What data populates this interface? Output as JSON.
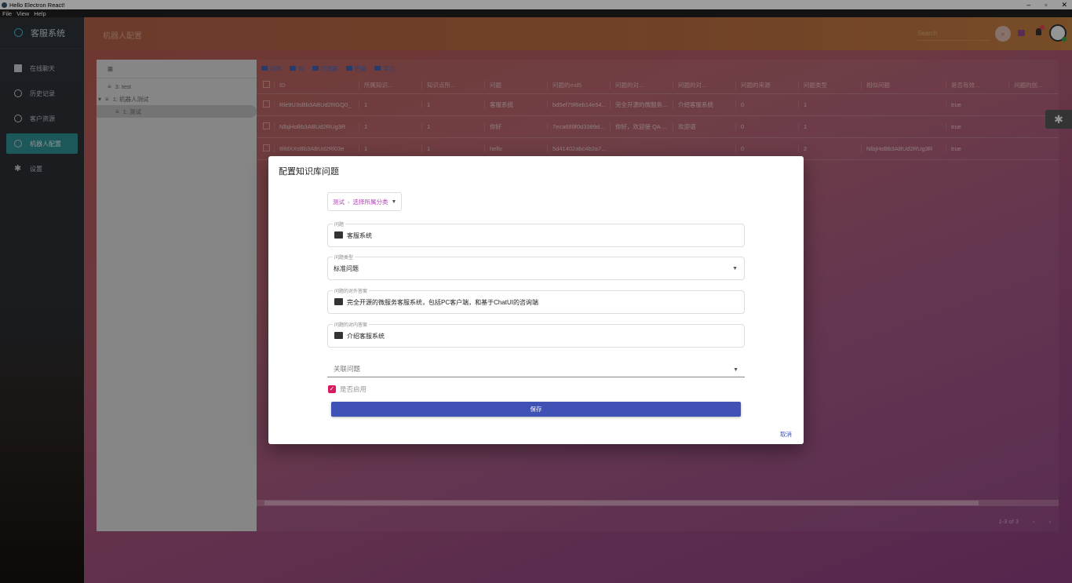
{
  "window": {
    "title": "Hello Electron React!"
  },
  "menu": [
    "File",
    "View",
    "Help"
  ],
  "sidebar": {
    "brand": "客服系统",
    "items": [
      {
        "label": "在线聊天"
      },
      {
        "label": "历史记录"
      },
      {
        "label": "客户资源"
      },
      {
        "label": "机器人配置"
      },
      {
        "label": "设置"
      }
    ]
  },
  "header": {
    "title": "机器人配置",
    "search_placeholder": "Search"
  },
  "tree": {
    "nodes": [
      {
        "label": "3: test"
      },
      {
        "label": "1: 机器人测试"
      },
      {
        "label": "1: 测试"
      }
    ]
  },
  "table": {
    "toolbar": [
      "列表",
      "列",
      "过滤器",
      "密度",
      "导出"
    ],
    "columns": [
      "ID",
      "所属知识...",
      "知识点所...",
      "问题",
      "问题的md5",
      "问题的对...",
      "问题的对...",
      "问题的来源",
      "问题类型",
      "相似问题",
      "是否有效...",
      "问题的创..."
    ],
    "rows": [
      [
        "Rle9U3sBb3ABUd2RGQ0_",
        "1",
        "1",
        "客服系统",
        "bd5ef79f6eb14e54...",
        "完全开源的微服务...",
        "介绍客服系统",
        "0",
        "1",
        "",
        "true",
        ""
      ],
      [
        "NlbjHoBb3ABUd2RUg3R",
        "1",
        "1",
        "你好",
        "7eca689f0d3389d...",
        "你好，欢迎使 QA ...",
        "欢迎语",
        "0",
        "1",
        "",
        "true",
        ""
      ],
      [
        "8ifdXXsBb3ABUd2Rl03e",
        "1",
        "1",
        "hello",
        "5d41402abc4b2a7...",
        "",
        "",
        "0",
        "2",
        "NlbjHoBb3ABUd2RUg3R",
        "true",
        ""
      ]
    ],
    "pager": {
      "range": "1-3 of 3",
      "prev": "‹",
      "next": "›"
    }
  },
  "dialog": {
    "title": "配置知识库问题",
    "breadcrumb": {
      "first": "测试",
      "separator": "›",
      "second": "选择所属分类",
      "arrow": "▼"
    },
    "fields": {
      "question": {
        "label": "问题",
        "value": "客服系统"
      },
      "type": {
        "label": "问题类型",
        "value": "标准问题"
      },
      "answer_external": {
        "label": "问题的对外答案",
        "value": "完全开源的微服务客服系统，包括PC客户端，和基于ChatUI的咨询端"
      },
      "answer_internal": {
        "label": "问题的对内答案",
        "value": "介绍客服系统"
      }
    },
    "related": {
      "placeholder": "关联问题"
    },
    "enabled": {
      "label": "是否启用",
      "checked": true
    },
    "save_label": "保存",
    "cancel_label": "取消"
  },
  "colors": {
    "accent": "#3f51b5",
    "checkbox": "#d81b60",
    "active_nav": "#2e8d92",
    "breadcrumb": "#b045b6"
  }
}
